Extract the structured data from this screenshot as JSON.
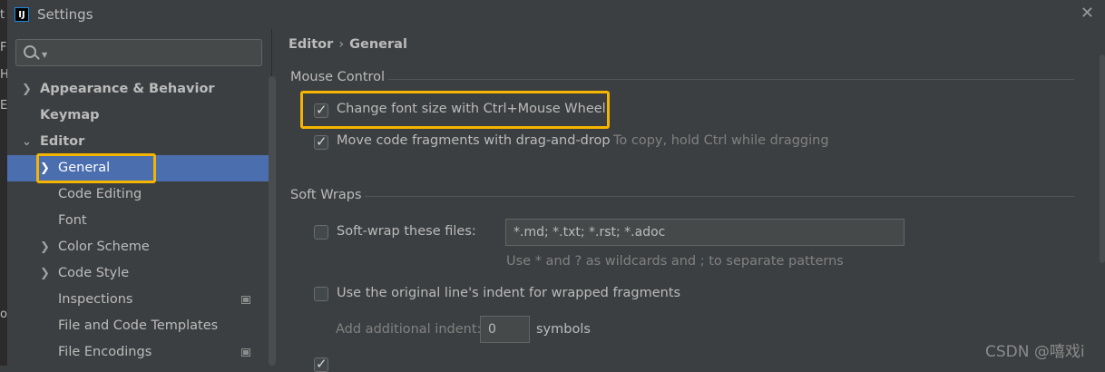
{
  "window": {
    "title": "Settings",
    "app_icon_text": "IJ"
  },
  "left_strip_glyphs": [
    "t",
    "F",
    "H",
    "E",
    "o"
  ],
  "search": {
    "placeholder": ""
  },
  "sidebar": {
    "items": [
      {
        "label": "Appearance & Behavior",
        "bold": true,
        "chevron": "right"
      },
      {
        "label": "Keymap",
        "bold": true
      },
      {
        "label": "Editor",
        "bold": true,
        "chevron": "down"
      },
      {
        "label": "General",
        "chevron": "right",
        "selected": true
      },
      {
        "label": "Code Editing"
      },
      {
        "label": "Font"
      },
      {
        "label": "Color Scheme",
        "chevron": "right"
      },
      {
        "label": "Code Style",
        "chevron": "right"
      },
      {
        "label": "Inspections",
        "project_icon": true
      },
      {
        "label": "File and Code Templates"
      },
      {
        "label": "File Encodings",
        "project_icon": true
      }
    ]
  },
  "breadcrumb": {
    "parent": "Editor",
    "separator": "›",
    "current": "General"
  },
  "mouse_control": {
    "title": "Mouse Control",
    "ctrl_wheel": {
      "label": "Change font size with Ctrl+Mouse Wheel",
      "checked": true
    },
    "drag_drop": {
      "label": "Move code fragments with drag-and-drop",
      "checked": true,
      "hint": "To copy, hold Ctrl while dragging"
    }
  },
  "soft_wraps": {
    "title": "Soft Wraps",
    "files": {
      "label": "Soft-wrap these files:",
      "checked": false,
      "value": "*.md; *.txt; *.rst; *.adoc"
    },
    "pattern_hint": "Use * and ? as wildcards and ; to separate patterns",
    "original_indent": {
      "label": "Use the original line's indent for wrapped fragments",
      "checked": false
    },
    "additional_indent": {
      "label": "Add additional indent:",
      "value": "0",
      "unit": "symbols"
    },
    "partial_row": {
      "checked": true
    }
  },
  "watermark": "CSDN @嘻戏i",
  "colors": {
    "accent_selection": "#4b6eaf",
    "highlight": "#f5b400",
    "background": "#3c3f41"
  }
}
